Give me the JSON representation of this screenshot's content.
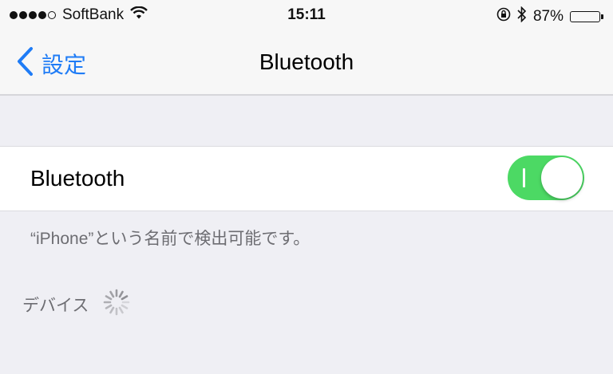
{
  "status_bar": {
    "carrier": "SoftBank",
    "time": "15:11",
    "battery_percent": "87%",
    "battery_level": 0.87,
    "icons": [
      "signal-dots-icon",
      "wifi-icon",
      "orientation-lock-icon",
      "bluetooth-icon",
      "battery-icon"
    ]
  },
  "nav": {
    "back_label": "設定",
    "title": "Bluetooth"
  },
  "bluetooth_row": {
    "label": "Bluetooth",
    "enabled": true
  },
  "footer_text": "“iPhone”という名前で検出可能です。",
  "devices": {
    "header": "デバイス",
    "loading": true
  },
  "colors": {
    "accent": "#1f7cf6",
    "toggle_on": "#4cd964",
    "background": "#efeff4",
    "secondary_text": "#6d6d72"
  }
}
